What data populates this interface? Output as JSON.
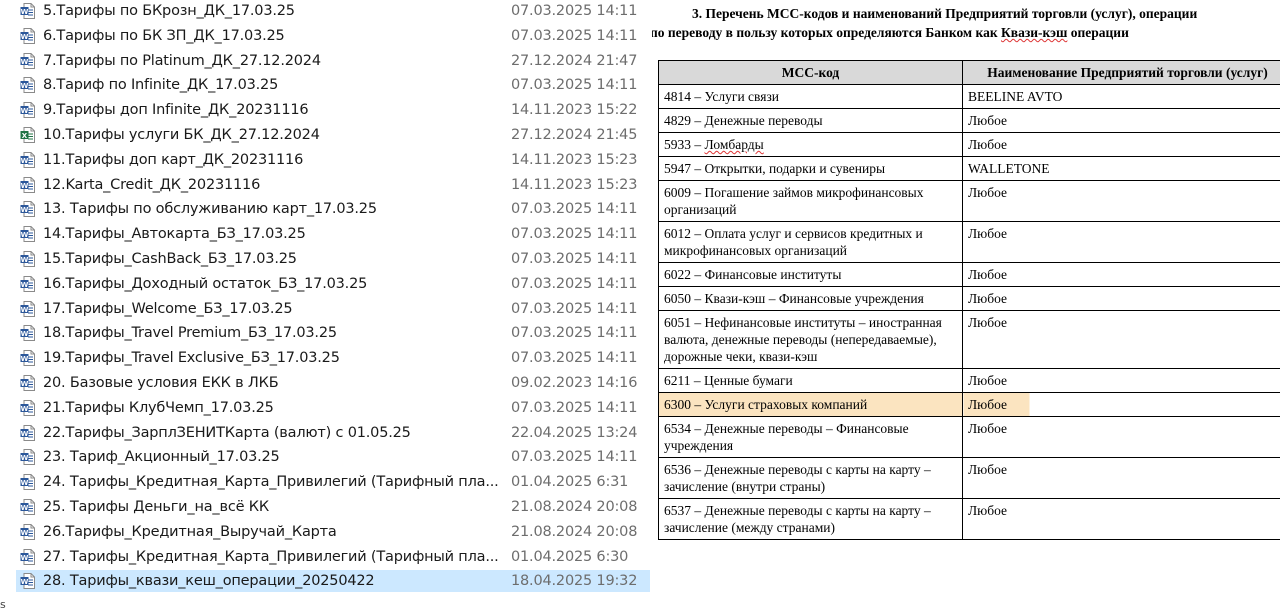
{
  "file_list": {
    "rows": [
      {
        "icon": "word-icon",
        "name": "5.Тарифы по БКрозн_ДК_17.03.25",
        "date": "07.03.2025 14:11",
        "selected": false
      },
      {
        "icon": "word-icon",
        "name": "6.Тарифы по БК ЗП_ДК_17.03.25",
        "date": "07.03.2025 14:11",
        "selected": false
      },
      {
        "icon": "word-icon",
        "name": "7.Тарифы по Platinum_ДК_27.12.2024",
        "date": "27.12.2024 21:47",
        "selected": false
      },
      {
        "icon": "word-icon",
        "name": "8.Тариф по Infinite_ДК_17.03.25",
        "date": "07.03.2025 14:11",
        "selected": false
      },
      {
        "icon": "word-icon",
        "name": "9.Тарифы доп Infinite_ДК_20231116",
        "date": "14.11.2023 15:22",
        "selected": false
      },
      {
        "icon": "excel-icon",
        "name": "10.Тарифы услуги БК_ДК_27.12.2024",
        "date": "27.12.2024 21:45",
        "selected": false
      },
      {
        "icon": "word-icon",
        "name": "11.Тарифы доп карт_ДК_20231116",
        "date": "14.11.2023 15:23",
        "selected": false
      },
      {
        "icon": "word-icon",
        "name": "12.Karta_Credit_ДК_20231116",
        "date": "14.11.2023 15:23",
        "selected": false
      },
      {
        "icon": "word-icon",
        "name": "13. Тарифы по обслуживанию карт_17.03.25",
        "date": "07.03.2025 14:11",
        "selected": false
      },
      {
        "icon": "word-icon",
        "name": "14.Тарифы_Автокарта_БЗ_17.03.25",
        "date": "07.03.2025 14:11",
        "selected": false
      },
      {
        "icon": "word-icon",
        "name": "15.Тарифы_CashBack_БЗ_17.03.25",
        "date": "07.03.2025 14:11",
        "selected": false
      },
      {
        "icon": "word-icon",
        "name": "16.Тарифы_Доходный остаток_БЗ_17.03.25",
        "date": "07.03.2025 14:11",
        "selected": false
      },
      {
        "icon": "word-icon",
        "name": "17.Тарифы_Welcome_БЗ_17.03.25",
        "date": "07.03.2025 14:11",
        "selected": false
      },
      {
        "icon": "word-icon",
        "name": "18.Тарифы_Travel Premium_БЗ_17.03.25",
        "date": "07.03.2025 14:11",
        "selected": false
      },
      {
        "icon": "word-icon",
        "name": "19.Тарифы_Travel Exclusive_БЗ_17.03.25",
        "date": "07.03.2025 14:11",
        "selected": false
      },
      {
        "icon": "word-icon",
        "name": "20. Базовые условия ЕКК в ЛКБ",
        "date": "09.02.2023 14:16",
        "selected": false
      },
      {
        "icon": "word-icon",
        "name": "21.Тарифы КлубЧемп_17.03.25",
        "date": "07.03.2025 14:11",
        "selected": false
      },
      {
        "icon": "word-icon",
        "name": "22.Тарифы_ЗарплЗЕНИТКарта (валют) с 01.05.25",
        "date": "22.04.2025 13:24",
        "selected": false
      },
      {
        "icon": "word-icon",
        "name": "23. Тариф_Акционный_17.03.25",
        "date": "07.03.2025 14:11",
        "selected": false
      },
      {
        "icon": "word-icon",
        "name": "24. Тарифы_Кредитная_Карта_Привилегий (Тарифный пла...",
        "date": "01.04.2025 6:31",
        "selected": false
      },
      {
        "icon": "word-icon",
        "name": "25. Тарифы Деньги_на_всё КК",
        "date": "21.08.2024 20:08",
        "selected": false
      },
      {
        "icon": "word-icon",
        "name": "26.Тарифы_Кредитная_Выручай_Карта",
        "date": "21.08.2024 20:08",
        "selected": false
      },
      {
        "icon": "word-icon",
        "name": "27. Тарифы_Кредитная_Карта_Привилегий (Тарифный пла...",
        "date": "01.04.2025 6:30",
        "selected": false
      },
      {
        "icon": "word-icon",
        "name": "28. Тарифы_квази_кеш_операции_20250422",
        "date": "18.04.2025 19:32",
        "selected": true
      }
    ],
    "stray_mark": "s"
  },
  "document": {
    "heading_line1": "3. Перечень МСС-кодов и наименований Предприятий торговли (услуг), операции",
    "heading_line2_pre": "по переводу в пользу которых определяются Банком как ",
    "heading_line2_word": "Квази-кэш",
    "heading_line2_post": " операции",
    "table": {
      "col1_header": "МСС-код",
      "col2_header": "Наименование Предприятий торговли (услуг)",
      "rows": [
        {
          "code": "4814 – Услуги связи",
          "merchant": "BEELINE AVTO"
        },
        {
          "code": "4829 – Денежные переводы",
          "merchant": "Любое"
        },
        {
          "code": "5933 – Ломбарды",
          "merchant": "Любое"
        },
        {
          "code": "5947 – Открытки, подарки и сувениры",
          "merchant": "WALLETONE"
        },
        {
          "code": "6009 – Погашение займов микрофинансовых организаций",
          "merchant": "Любое"
        },
        {
          "code": "6012 – Оплата услуг и сервисов кредитных и микрофинансовых организаций",
          "merchant": "Любое"
        },
        {
          "code": "6022 – Финансовые институты",
          "merchant": "Любое"
        },
        {
          "code": "6050 – Квази-кэш – Финансовые учреждения",
          "merchant": "Любое"
        },
        {
          "code": "6051 – Нефинансовые институты – иностранная валюта, денежные переводы (непередаваемые), дорожные чеки, квази-кэш",
          "merchant": "Любое"
        },
        {
          "code": "6211 – Ценные бумаги",
          "merchant": "Любое"
        },
        {
          "code": "6300 – Услуги страховых компаний",
          "merchant": "Любое",
          "highlight": true
        },
        {
          "code": "6534 – Денежные переводы – Финансовые учреждения",
          "merchant": "Любое"
        },
        {
          "code": "6536 – Денежные переводы с карты на карту – зачисление (внутри страны)",
          "merchant": "Любое"
        },
        {
          "code": "6537 – Денежные переводы с карты на карту – зачисление (между странами)",
          "merchant": "Любое"
        }
      ]
    }
  },
  "colors": {
    "selection": "#cce8ff",
    "highlight": "#fbe4c0",
    "header_fill": "#d9d9d9",
    "word_icon": "#2b579a",
    "excel_icon": "#217346"
  }
}
